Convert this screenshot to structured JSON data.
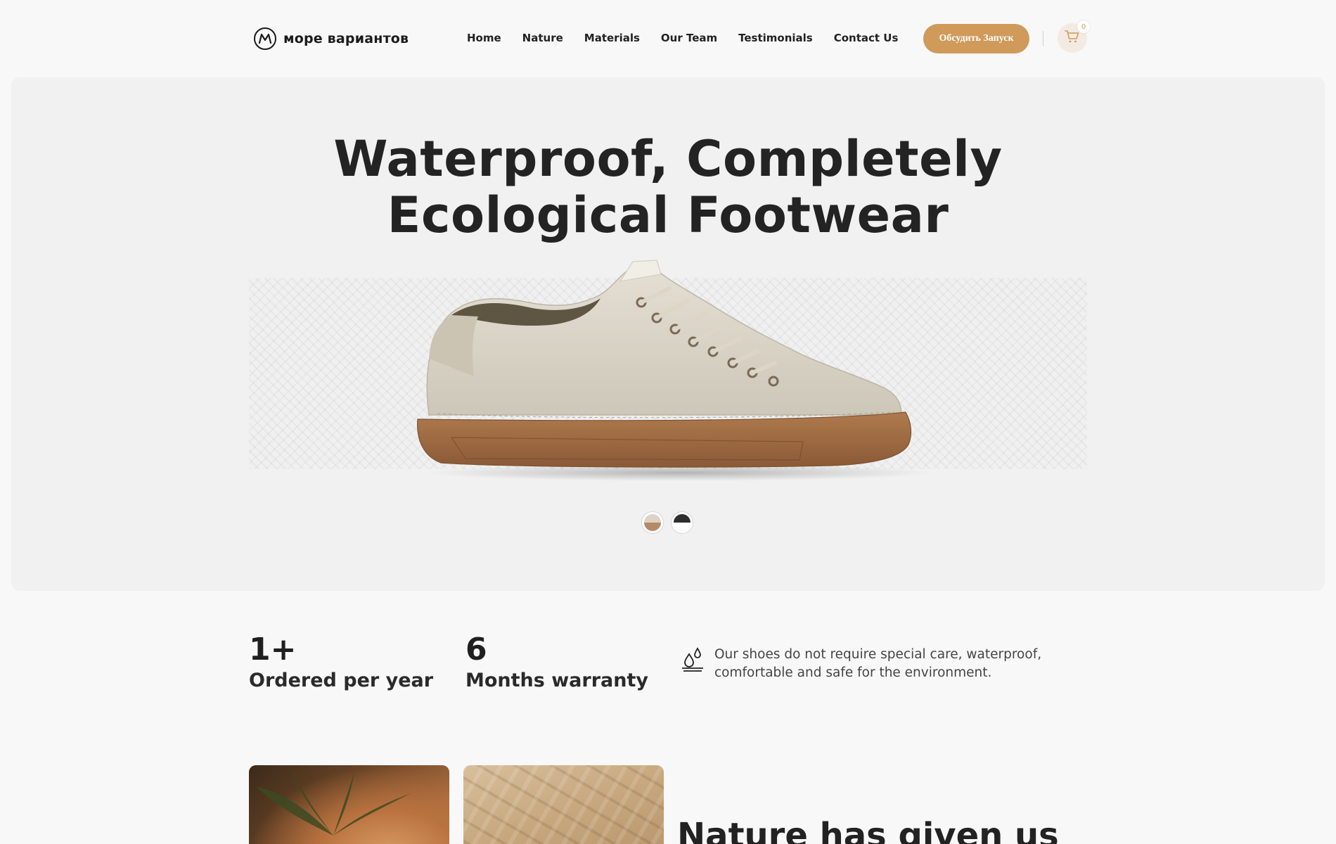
{
  "header": {
    "logo_text": "море вариантов",
    "nav": [
      "Home",
      "Nature",
      "Materials",
      "Our Team",
      "Testimonials",
      "Contact Us"
    ],
    "cta_label": "Обсудить Запуск",
    "cart_count": "0",
    "accent_color": "#cf9a5a"
  },
  "hero": {
    "title_line1": "Waterproof, Completely",
    "title_line2": "Ecological Footwear",
    "swatches": [
      "tan-swatch",
      "dark-swatch"
    ]
  },
  "stats": [
    {
      "value": "1+",
      "label": "Ordered per year"
    },
    {
      "value": "6",
      "label": "Months warranty"
    }
  ],
  "feature": {
    "icon": "water-drops-icon",
    "text": "Our shoes do not require special care, waterproof, comfortable and safe for the environment."
  },
  "section": {
    "title": "Nature has given us"
  }
}
